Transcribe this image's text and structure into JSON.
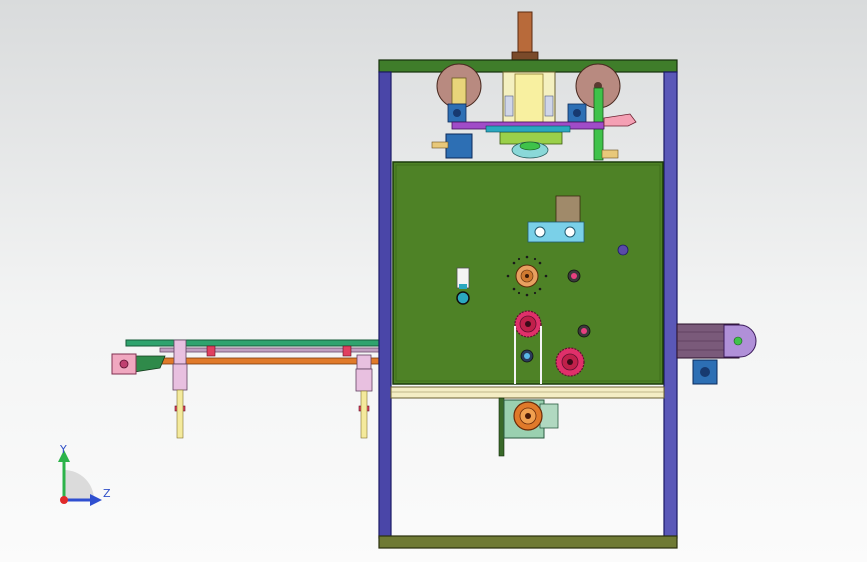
{
  "colors": {
    "frame_post": "#4a46a8",
    "frame_post_edge": "#1c1a66",
    "top_beam": "#3f7d2a",
    "bottom_beam": "#6f7a34",
    "main_panel": "#4e8226",
    "conveyor_belt": "#1f8a5a",
    "orange_rail": "#e07a2a",
    "gear_red": "#e0306a",
    "motor_blue": "#2d6fb4",
    "axis_y": "#2cb34a",
    "axis_z": "#2f4fd0",
    "axis_origin": "#e02a2a"
  },
  "axes": {
    "y_label": "Y",
    "z_label": "Z"
  }
}
